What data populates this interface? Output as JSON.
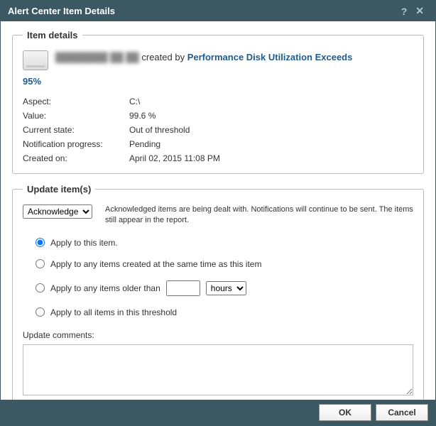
{
  "titlebar": {
    "title": "Alert Center Item Details"
  },
  "item_details": {
    "legend": "Item details",
    "obscured_name": "████████ ██ ██",
    "created_by_label": "created by",
    "threshold_link": "Performance Disk Utilization Exceeds",
    "percent_line": "95%",
    "fields": {
      "aspect": {
        "label": "Aspect:",
        "value": "C:\\"
      },
      "value": {
        "label": "Value:",
        "value": "99.6 %"
      },
      "current_state": {
        "label": "Current state:",
        "value": "Out of threshold"
      },
      "notification_progress": {
        "label": "Notification progress:",
        "value": "Pending"
      },
      "created_on": {
        "label": "Created on:",
        "value": "April 02, 2015 11:08 PM"
      }
    }
  },
  "update": {
    "legend": "Update item(s)",
    "action_options": [
      "Acknowledge"
    ],
    "action_selected": "Acknowledge",
    "description": "Acknowledged items are being dealt with. Notifications will continue to be sent. The items still appear in the report.",
    "radios": {
      "this_item": "Apply to this item.",
      "same_time": "Apply to any items created at the same time as this item",
      "older_than_prefix": "Apply to any items older than",
      "older_than_value": "",
      "older_than_unit_options": [
        "hours"
      ],
      "older_than_unit_selected": "hours",
      "all_items": "Apply to all items in this threshold"
    },
    "comments_label": "Update comments:",
    "comments_value": ""
  },
  "footer": {
    "ok": "OK",
    "cancel": "Cancel"
  }
}
